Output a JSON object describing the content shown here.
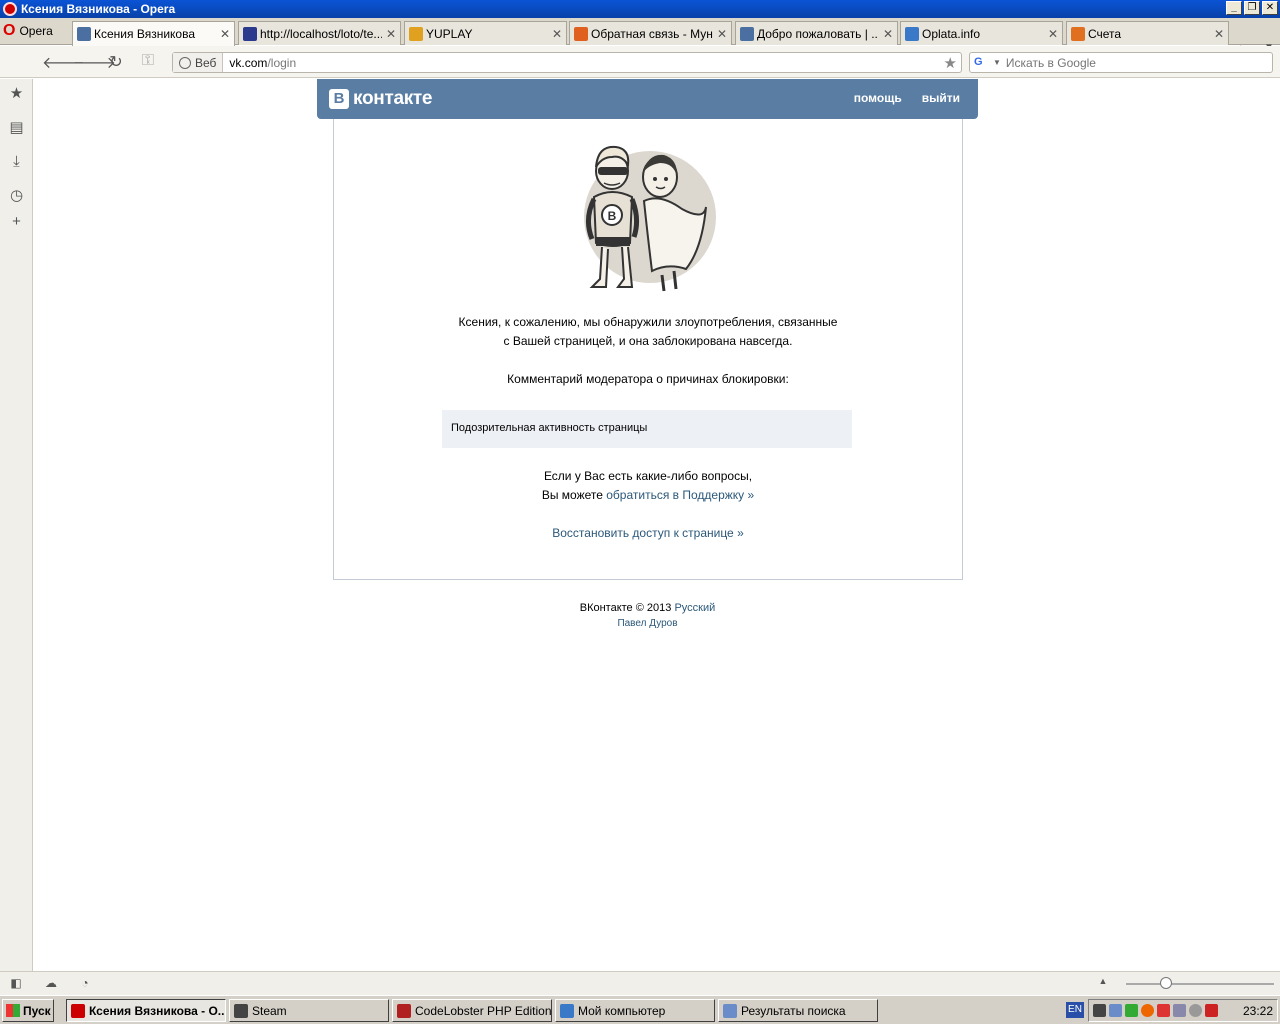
{
  "window": {
    "title": "Ксения Вязникова - Opera"
  },
  "browser": {
    "menu_label": "Opera",
    "tabs": [
      {
        "label": "Ксения Вязникова",
        "icon": "vk-icon",
        "color": "#4a6fa0",
        "active": true
      },
      {
        "label": "http://localhost/loto/te...",
        "icon": "s-icon",
        "color": "#2b3a8c",
        "active": false
      },
      {
        "label": "YUPLAY",
        "icon": "yuplay-icon",
        "color": "#e0a020",
        "active": false
      },
      {
        "label": "Обратная связь - Мун...",
        "icon": "joomla-icon",
        "color": "#e06020",
        "active": false
      },
      {
        "label": "Добро пожаловать | ...",
        "icon": "vk-icon",
        "color": "#4a6fa0",
        "active": false
      },
      {
        "label": "Oplata.info",
        "icon": "globe-icon",
        "color": "#3a78c8",
        "active": false
      },
      {
        "label": "Счета",
        "icon": "search-o-icon",
        "color": "#e07020",
        "active": false
      }
    ],
    "address": {
      "badge": "Веб",
      "host": "vk.com",
      "path": "/login"
    },
    "search_placeholder": "Искать в Google"
  },
  "vk": {
    "logo_letter": "В",
    "logo_text": "контакте",
    "menu": {
      "help": "помощь",
      "logout": "выйти"
    },
    "message_line1": "Ксения, к сожалению, мы обнаружили злоупотребления, связанные",
    "message_line2": "с Вашей страницей, и она заблокирована навсегда.",
    "comment_label": "Комментарий модератора о причинах блокировки:",
    "comment_text": "Подозрительная активность страницы",
    "questions_line1": "Если у Вас есть какие-либо вопросы,",
    "questions_line2_prefix": "Вы можете ",
    "support_link": "обратиться в Поддержку »",
    "restore_link": "Восстановить доступ к странице »",
    "footer": {
      "copyright": "ВКонтакте © 2013",
      "language": "Русский",
      "author": "Павел Дуров"
    }
  },
  "taskbar": {
    "start_label": "Пуск",
    "tasks": [
      {
        "label": "Ксения Вязникова - О...",
        "color": "#c00",
        "active": true
      },
      {
        "label": "Steam",
        "color": "#444",
        "active": false
      },
      {
        "label": "CodeLobster PHP Edition...",
        "color": "#b02020",
        "active": false
      },
      {
        "label": "Мой компьютер",
        "color": "#3a78c8",
        "active": false
      },
      {
        "label": "Результаты поиска",
        "color": "#6a8cc8",
        "active": false
      }
    ],
    "lang": "EN",
    "clock": "23:22"
  }
}
